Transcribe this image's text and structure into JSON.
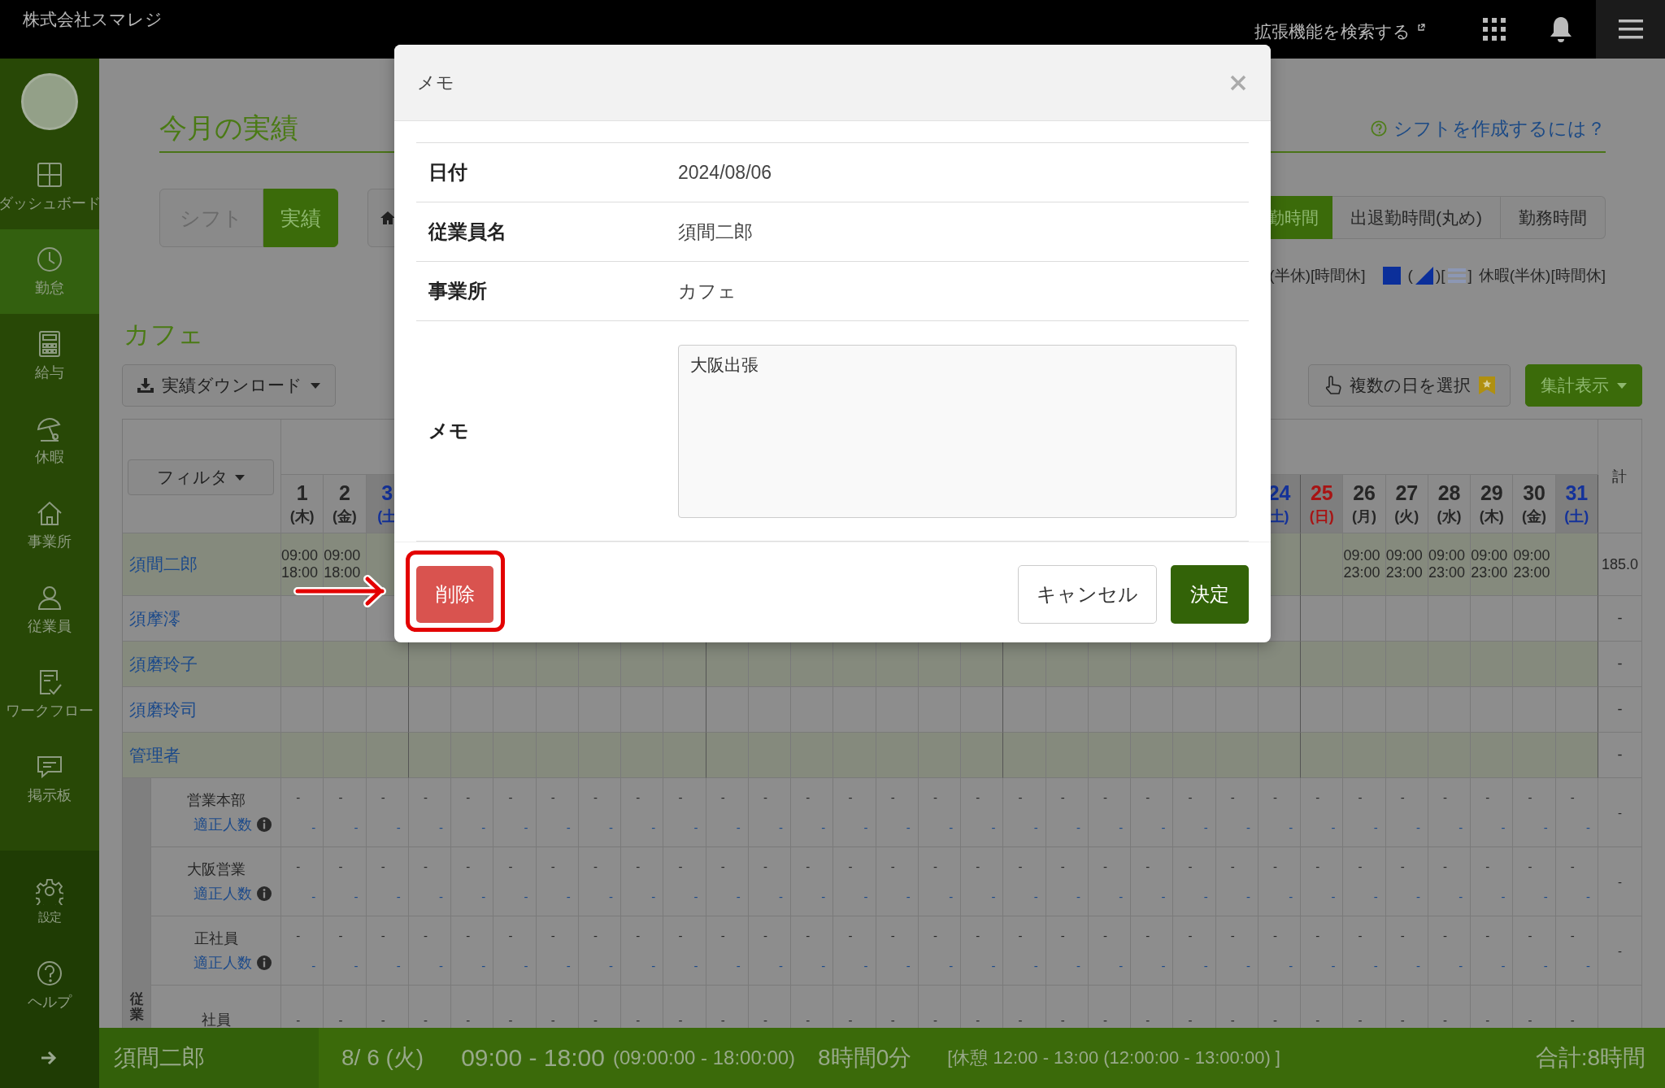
{
  "header": {
    "company": "株式会社スマレジ",
    "extension_search": "拡張機能を検索する"
  },
  "sidebar": {
    "items": [
      {
        "label": "ダッシュボード",
        "kind": "dashboard",
        "selected": false
      },
      {
        "label": "勤怠",
        "kind": "clock",
        "selected": true
      },
      {
        "label": "給与",
        "kind": "calculator",
        "selected": false
      },
      {
        "label": "休暇",
        "kind": "umbrella",
        "selected": false
      },
      {
        "label": "事業所",
        "kind": "home",
        "selected": false
      },
      {
        "label": "従業員",
        "kind": "person",
        "selected": false
      },
      {
        "label": "ワークフロー",
        "kind": "checklist",
        "selected": false
      },
      {
        "label": "掲示板",
        "kind": "chat",
        "selected": false
      }
    ],
    "bottom_items": [
      {
        "label": "設定",
        "kind": "gear",
        "selected": false
      },
      {
        "label": "ヘルプ",
        "kind": "help",
        "selected": false
      }
    ]
  },
  "page": {
    "title": "今月の実績",
    "help_link": "シフトを作成するには？",
    "mode_tabs": [
      {
        "label": "シフト",
        "selected": false
      },
      {
        "label": "実績",
        "selected": true
      }
    ],
    "time_tabs": [
      {
        "label": "勤時間",
        "selected": true
      },
      {
        "label": "出退勤時間(丸め)",
        "selected": false
      },
      {
        "label": "勤務時間",
        "selected": false
      }
    ],
    "legend": {
      "left_text": "(半休)[時間休]",
      "open": "(",
      "middle": ")[",
      "close": "]",
      "label": "休暇(半休)[時間休]"
    }
  },
  "section": {
    "title": "カフェ",
    "download_button": "実績ダウンロード",
    "multi_select_button": "複数の日を選択",
    "summary_button": "集計表示",
    "filter_button": "フィルタ"
  },
  "table": {
    "total_header": "計",
    "days_left": [
      {
        "num": "1",
        "weekday": "(木)",
        "kind": "weekday"
      },
      {
        "num": "2",
        "weekday": "(金)",
        "kind": "weekday"
      },
      {
        "num": "3",
        "weekday": "(土",
        "kind": "saturday"
      }
    ],
    "days_right": [
      {
        "num": "24",
        "weekday": "土)",
        "kind": "saturday"
      },
      {
        "num": "25",
        "weekday": "(日)",
        "kind": "sunday"
      },
      {
        "num": "26",
        "weekday": "(月)",
        "kind": "weekday"
      },
      {
        "num": "27",
        "weekday": "(火)",
        "kind": "weekday"
      },
      {
        "num": "28",
        "weekday": "(水)",
        "kind": "weekday"
      },
      {
        "num": "29",
        "weekday": "(木)",
        "kind": "weekday"
      },
      {
        "num": "30",
        "weekday": "(金)",
        "kind": "weekday"
      },
      {
        "num": "31",
        "weekday": "(土)",
        "kind": "saturday"
      }
    ],
    "employees": [
      {
        "name": "須間二郎",
        "cells_left": [
          {
            "kind": "shift",
            "start": "09:00",
            "end": "18:00"
          },
          {
            "kind": "shift",
            "start": "09:00",
            "end": "18:00"
          },
          {
            "kind": "empty"
          }
        ],
        "cells_right": [
          {
            "kind": "empty"
          },
          {
            "kind": "empty"
          },
          {
            "kind": "shift",
            "start": "09:00",
            "end": "23:00"
          },
          {
            "kind": "shift",
            "start": "09:00",
            "end": "23:00"
          },
          {
            "kind": "shift",
            "start": "09:00",
            "end": "23:00"
          },
          {
            "kind": "shift",
            "start": "09:00",
            "end": "23:00"
          },
          {
            "kind": "shift",
            "start": "09:00",
            "end": "23:00"
          },
          {
            "kind": "empty"
          }
        ],
        "total": "185.0"
      },
      {
        "name": "須摩澪",
        "total": "-"
      },
      {
        "name": "須磨玲子",
        "total": "-"
      },
      {
        "name": "須磨玲司",
        "total": "-"
      },
      {
        "name": "管理者",
        "total": "-"
      }
    ],
    "group_label": "従業",
    "groups": [
      {
        "name": "営業本部",
        "sub": "適正人数",
        "total": "-",
        "upper": [
          "-",
          "-",
          "-",
          "-",
          "-",
          "-",
          "-",
          "-",
          "-",
          "-",
          "-",
          "-",
          "-",
          "-",
          "-",
          "-",
          "-",
          "-",
          "-",
          "-",
          "-",
          "-",
          "-",
          "-",
          "-",
          "-",
          "-",
          "-",
          "-",
          "-",
          "-"
        ],
        "lower": [
          "-",
          "-",
          "-",
          "-",
          "-",
          "-",
          "-",
          "-",
          "-",
          "-",
          "-",
          "-",
          "-",
          "-",
          "-",
          "-",
          "-",
          "-",
          "-",
          "-",
          "-",
          "-",
          "-",
          "-",
          "-",
          "-",
          "-",
          "-",
          "-",
          "-",
          "-"
        ]
      },
      {
        "name": "大阪営業",
        "sub": "適正人数",
        "total": "-",
        "upper": [
          "-",
          "-",
          "-",
          "-",
          "-",
          "-",
          "-",
          "-",
          "-",
          "-",
          "-",
          "-",
          "-",
          "-",
          "-",
          "-",
          "-",
          "-",
          "-",
          "-",
          "-",
          "-",
          "-",
          "-",
          "-",
          "-",
          "-",
          "-",
          "-",
          "-",
          "-"
        ],
        "lower": [
          "-",
          "-",
          "-",
          "-",
          "-",
          "-",
          "-",
          "-",
          "-",
          "-",
          "-",
          "-",
          "-",
          "-",
          "-",
          "-",
          "-",
          "-",
          "-",
          "-",
          "-",
          "-",
          "-",
          "-",
          "-",
          "-",
          "-",
          "-",
          "-",
          "-",
          "-"
        ]
      },
      {
        "name": "正社員",
        "sub": "適正人数",
        "total": "-",
        "upper": [
          "-",
          "-",
          "-",
          "-",
          "-",
          "-",
          "-",
          "-",
          "-",
          "-",
          "-",
          "-",
          "-",
          "-",
          "-",
          "-",
          "-",
          "-",
          "-",
          "-",
          "-",
          "-",
          "-",
          "-",
          "-",
          "-",
          "-",
          "-",
          "-",
          "-",
          "-"
        ],
        "lower": [
          "-",
          "-",
          "-",
          "-",
          "-",
          "-",
          "-",
          "-",
          "-",
          "-",
          "-",
          "-",
          "-",
          "-",
          "-",
          "-",
          "-",
          "-",
          "-",
          "-",
          "-",
          "-",
          "-",
          "-",
          "-",
          "-",
          "-",
          "-",
          "-",
          "-",
          "-"
        ]
      },
      {
        "name": "社員",
        "upper": [
          "-",
          "-",
          "-",
          "-",
          "-",
          "-",
          "-",
          "-",
          "-",
          "-",
          "-",
          "-",
          "-",
          "-",
          "-",
          "-",
          "-",
          "-",
          "-",
          "-",
          "-",
          "-",
          "-",
          "-",
          "-",
          "-",
          "-",
          "-",
          "-",
          "-",
          "-"
        ]
      }
    ]
  },
  "bottom_bar": {
    "employee": "須間二郎",
    "date": "8/ 6 (火)",
    "time": "09:00 - 18:00",
    "time_exact": "(09:00:00 - 18:00:00)",
    "duration": "8時間0分",
    "break": "[休憩 12:00 - 13:00 (12:00:00 - 13:00:00) ]",
    "total": "合計:8時間"
  },
  "modal": {
    "title": "メモ",
    "fields": [
      {
        "label": "日付",
        "value": "2024/08/06"
      },
      {
        "label": "従業員名",
        "value": "須間二郎"
      },
      {
        "label": "事業所",
        "value": "カフェ"
      }
    ],
    "memo": {
      "label": "メモ",
      "value": "大阪出張"
    },
    "buttons": {
      "delete": "削除",
      "cancel": "キャンセル",
      "confirm": "決定"
    }
  }
}
